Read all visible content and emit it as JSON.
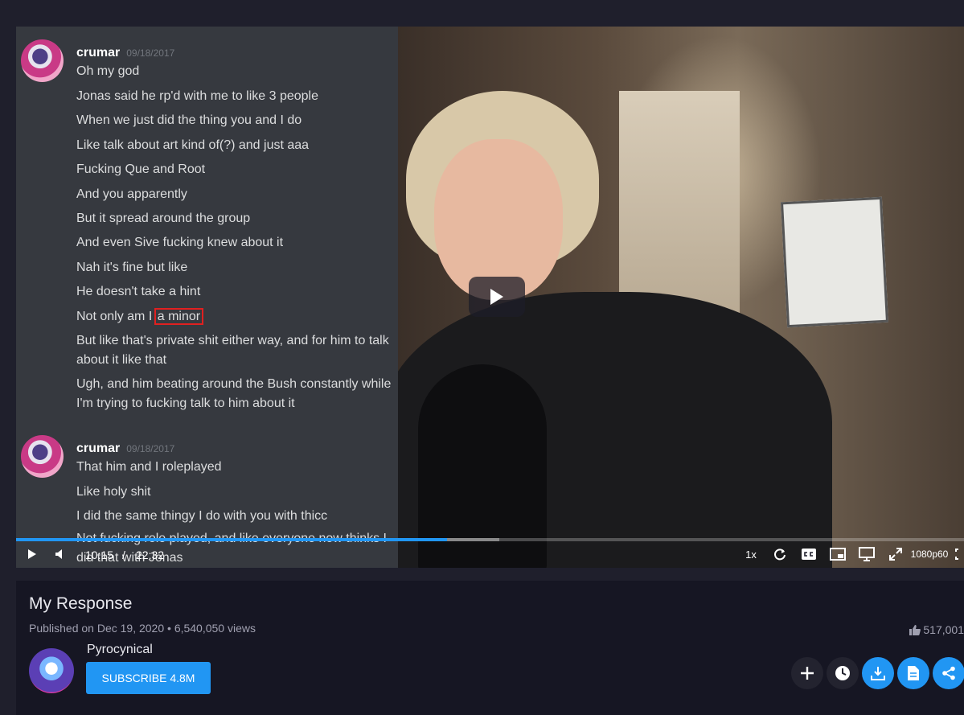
{
  "chat": {
    "groups": [
      {
        "author": "crumar",
        "date": "09/18/2017",
        "lines": [
          "Oh my god",
          "Jonas said he rp'd with me to like 3 people",
          "When we just did the thing you and I do",
          "Like talk about art kind of(?) and just aaa",
          "Fucking Que and Root",
          "And you apparently",
          "But it spread around the group",
          "And even Sive fucking knew about it",
          "Nah it's fine but like",
          "He doesn't take a hint",
          "But like that's private shit either way, and for him to talk about it like that",
          "Ugh, and him beating around the Bush constantly while I'm trying to fucking talk to him about it"
        ],
        "highlight_line_prefix": "Not only am I",
        "highlight_text": "a minor"
      },
      {
        "author": "crumar",
        "date": "09/18/2017",
        "lines": [
          "That him and I roleplayed",
          "Like holy shit",
          "I did the same thingy I do with you with thicc",
          "Not fucking role played, and like everyone now thinks I did that with Jonas"
        ]
      }
    ]
  },
  "player": {
    "current_time": "10:15",
    "separator": "/",
    "duration": "22:32",
    "played_fraction": 0.455,
    "buffered_fraction": 0.51,
    "speed": "1x",
    "quality": "1080p60"
  },
  "video": {
    "title": "My Response",
    "published": "Published on Dec 19, 2020",
    "views": "6,540,050 views",
    "likes": "517,001"
  },
  "channel": {
    "name": "Pyrocynical",
    "subscribe_label": "SUBSCRIBE 4.8M"
  },
  "colors": {
    "accent": "#2196f3",
    "background": "#1f1f2c",
    "panel": "#161623",
    "chat_bg": "#36393f",
    "highlight": "#e02020"
  }
}
